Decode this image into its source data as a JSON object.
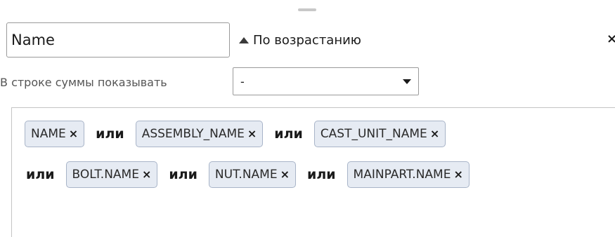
{
  "field": {
    "value": "Name"
  },
  "sort": {
    "label": "По возрастанию",
    "icon": "sort-ascending-icon"
  },
  "close": {
    "glyph": "×"
  },
  "summary": {
    "label": "В строке суммы показывать",
    "selected": "-"
  },
  "filter": {
    "connector": "или",
    "row1": [
      "NAME",
      "ASSEMBLY_NAME",
      "CAST_UNIT_NAME"
    ],
    "row2": [
      "BOLT.NAME",
      "NUT.NAME",
      "MAINPART.NAME"
    ],
    "remove_glyph": "×"
  },
  "colors": {
    "tag_background": "#e6ebf3",
    "tag_border": "#a8b4c8"
  }
}
